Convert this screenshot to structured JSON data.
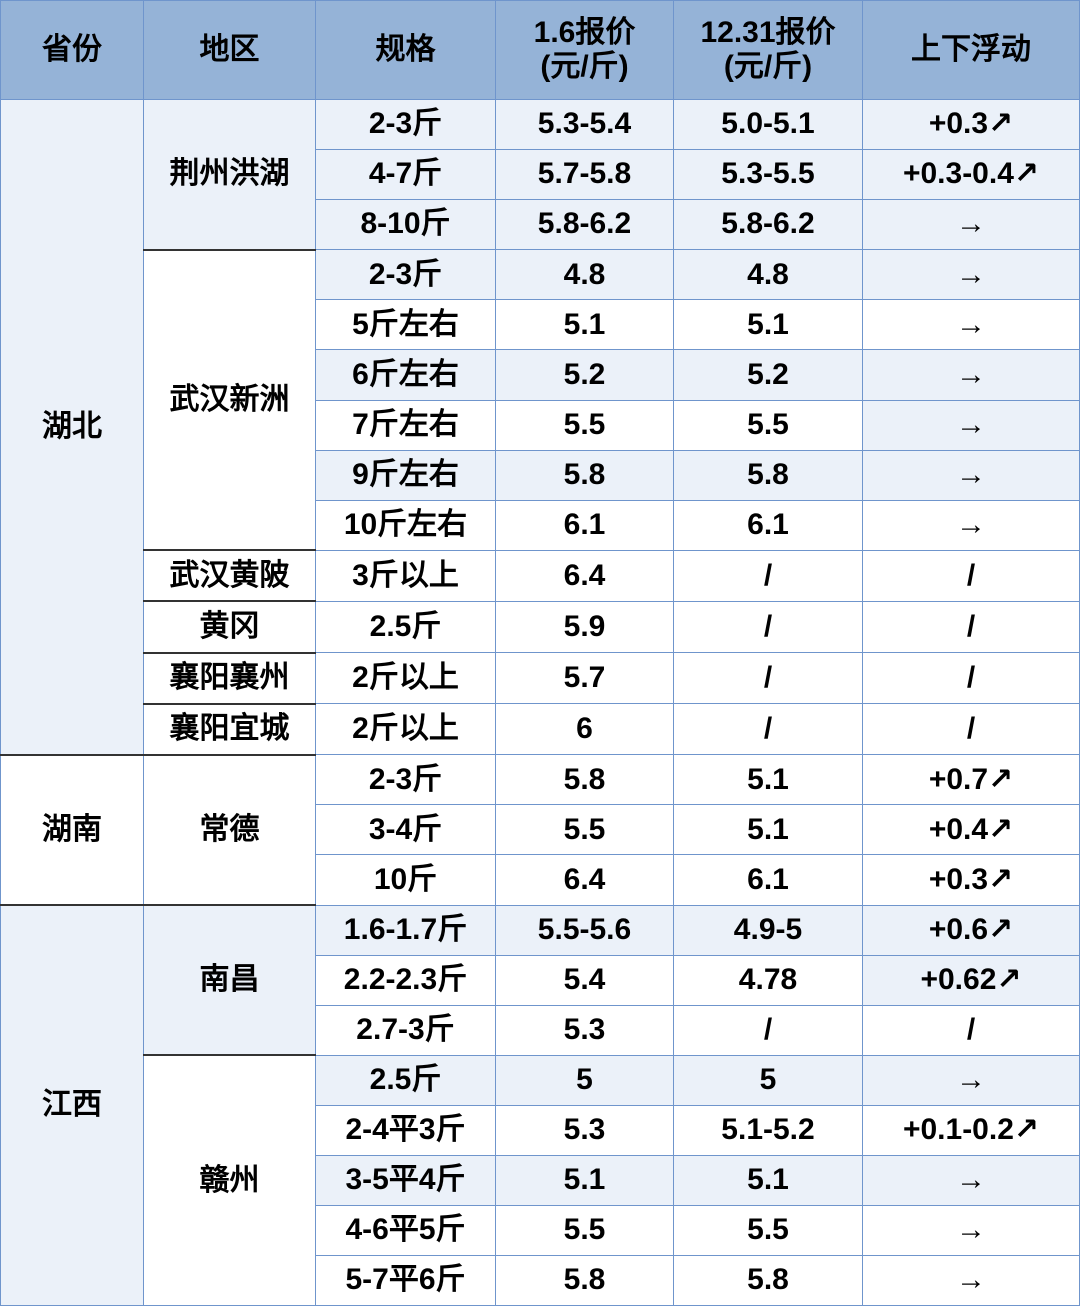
{
  "header": [
    "省份",
    "地区",
    "规格",
    "1.6报价\n(元/斤)",
    "12.31报价\n(元/斤)",
    "上下浮动"
  ],
  "colors": {
    "header_bg": "#95b3d7",
    "shaded_row": "#ebf1f9",
    "border": "#6f95cc"
  },
  "provinces": [
    {
      "name": "湖北",
      "regions": [
        {
          "name": "荆州洪湖",
          "rows": [
            [
              "2-3斤",
              "5.3-5.4",
              "5.0-5.1",
              "+0.3↗"
            ],
            [
              "4-7斤",
              "5.7-5.8",
              "5.3-5.5",
              "+0.3-0.4↗"
            ],
            [
              "8-10斤",
              "5.8-6.2",
              "5.8-6.2",
              "→"
            ]
          ]
        },
        {
          "name": "武汉新洲",
          "rows": [
            [
              "2-3斤",
              "4.8",
              "4.8",
              "→"
            ],
            [
              "5斤左右",
              "5.1",
              "5.1",
              "→"
            ],
            [
              "6斤左右",
              "5.2",
              "5.2",
              "→"
            ],
            [
              "7斤左右",
              "5.5",
              "5.5",
              "→"
            ],
            [
              "9斤左右",
              "5.8",
              "5.8",
              "→"
            ],
            [
              "10斤左右",
              "6.1",
              "6.1",
              "→"
            ]
          ]
        },
        {
          "name": "武汉黄陂",
          "rows": [
            [
              "3斤以上",
              "6.4",
              "/",
              "/"
            ]
          ]
        },
        {
          "name": "黄冈",
          "rows": [
            [
              "2.5斤",
              "5.9",
              "/",
              "/"
            ]
          ]
        },
        {
          "name": "襄阳襄州",
          "rows": [
            [
              "2斤以上",
              "5.7",
              "/",
              "/"
            ]
          ]
        },
        {
          "name": "襄阳宜城",
          "rows": [
            [
              "2斤以上",
              "6",
              "/",
              "/"
            ]
          ]
        }
      ]
    },
    {
      "name": "湖南",
      "regions": [
        {
          "name": "常德",
          "rows": [
            [
              "2-3斤",
              "5.8",
              "5.1",
              "+0.7↗"
            ],
            [
              "3-4斤",
              "5.5",
              "5.1",
              "+0.4↗"
            ],
            [
              "10斤",
              "6.4",
              "6.1",
              "+0.3↗"
            ]
          ]
        }
      ]
    },
    {
      "name": "江西",
      "regions": [
        {
          "name": "南昌",
          "rows": [
            [
              "1.6-1.7斤",
              "5.5-5.6",
              "4.9-5",
              "+0.6↗"
            ],
            [
              "2.2-2.3斤",
              "5.4",
              "4.78",
              "+0.62↗"
            ],
            [
              "2.7-3斤",
              "5.3",
              "/",
              "/"
            ]
          ]
        },
        {
          "name": "赣州",
          "rows": [
            [
              "2.5斤",
              "5",
              "5",
              "→"
            ],
            [
              "2-4平3斤",
              "5.3",
              "5.1-5.2",
              "+0.1-0.2↗"
            ],
            [
              "3-5平4斤",
              "5.1",
              "5.1",
              "→"
            ],
            [
              "4-6平5斤",
              "5.5",
              "5.5",
              "→"
            ],
            [
              "5-7平6斤",
              "5.8",
              "5.8",
              "→"
            ]
          ]
        }
      ]
    }
  ]
}
